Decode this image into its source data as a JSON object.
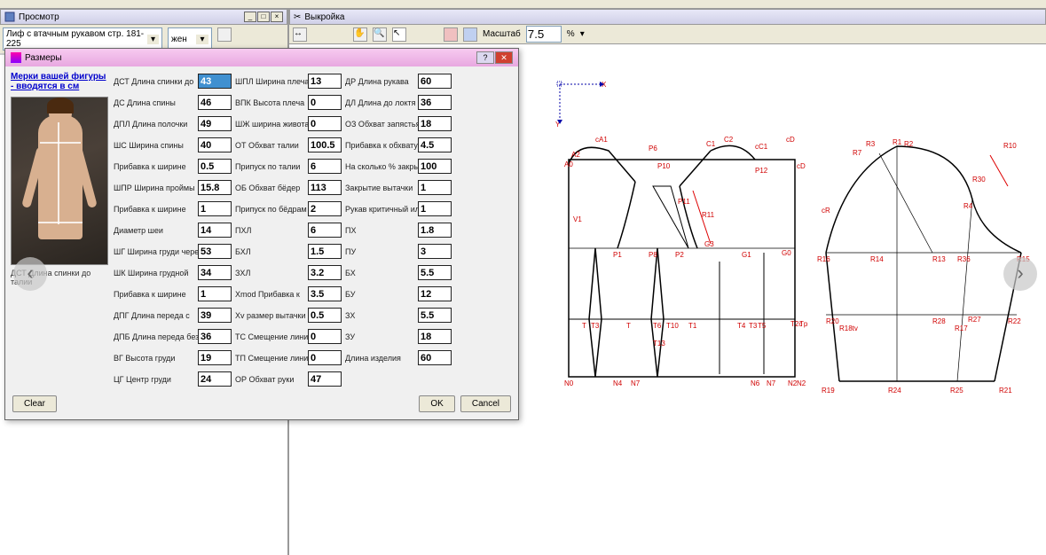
{
  "left_panel": {
    "title": "Просмотр",
    "combo_pattern": "Лиф с втачным рукавом стр. 181-225",
    "combo_gender": "жен"
  },
  "right_panel": {
    "title": "Выкройка",
    "scale_label": "Масштаб",
    "scale_value": "7.5",
    "scale_unit": "%"
  },
  "dialog": {
    "title": "Размеры",
    "link": "Мерки вашей фигуры - вводятся в см",
    "photo_caption": "ДСТ Длина спинки до талии",
    "buttons": {
      "clear": "Clear",
      "ok": "OK",
      "cancel": "Cancel"
    },
    "col1": [
      {
        "label": "ДСТ Длина спинки до",
        "value": "43",
        "hl": true
      },
      {
        "label": "ДС Длина спины",
        "value": "46"
      },
      {
        "label": "ДПЛ Длина полочки",
        "value": "49"
      },
      {
        "label": "ШС Ширина спины",
        "value": "40"
      },
      {
        "label": "Прибавка к ширине",
        "value": "0.5"
      },
      {
        "label": "ШПР Ширина проймы",
        "value": "15.8"
      },
      {
        "label": "Прибавка к ширине",
        "value": "1"
      },
      {
        "label": "Диаметр шеи",
        "value": "14"
      },
      {
        "label": "ШГ Ширина груди через",
        "value": "53"
      },
      {
        "label": "ШК Ширина грудной",
        "value": "34"
      },
      {
        "label": "Прибавка к ширине",
        "value": "1"
      },
      {
        "label": "ДПГ Длина переда с",
        "value": "39"
      },
      {
        "label": "ДПБ Длина переда без",
        "value": "36"
      },
      {
        "label": "ВГ Высота груди",
        "value": "19"
      },
      {
        "label": "ЦГ Центр груди",
        "value": "24"
      }
    ],
    "col2": [
      {
        "label": "ШПЛ Ширина плеча",
        "value": "13"
      },
      {
        "label": "ВПК Высота плеча",
        "value": "0"
      },
      {
        "label": "ШЖ ширина живота",
        "value": "0"
      },
      {
        "label": "ОТ Обхват талии",
        "value": "100.5"
      },
      {
        "label": "Припуск по талии",
        "value": "6"
      },
      {
        "label": "ОБ Обхват бёдер",
        "value": "113"
      },
      {
        "label": "Припуск по бёдрам",
        "value": "2"
      },
      {
        "label": "ПХЛ",
        "value": "6"
      },
      {
        "label": "БХЛ",
        "value": "1.5"
      },
      {
        "label": "ЗХЛ",
        "value": "3.2"
      },
      {
        "label": "Xmod Прибавка к",
        "value": "3.5"
      },
      {
        "label": "Xv размер вытачки на",
        "value": "0.5"
      },
      {
        "label": "ТС Смещение линии",
        "value": "0"
      },
      {
        "label": "ТП Смещение линии",
        "value": "0"
      },
      {
        "label": "ОР Обхват руки",
        "value": "47"
      }
    ],
    "col3": [
      {
        "label": "ДР Длина рукава",
        "value": "60"
      },
      {
        "label": "ДЛ Длина до локтя",
        "value": "36"
      },
      {
        "label": "ОЗ Обхват запястья",
        "value": "18"
      },
      {
        "label": "Прибавка к обхвату",
        "value": "4.5"
      },
      {
        "label": "На сколько % закрыть",
        "value": "100"
      },
      {
        "label": "Закрытие вытачки",
        "value": "1"
      },
      {
        "label": "Рукав критичный или",
        "value": "1"
      },
      {
        "label": "ПХ",
        "value": "1.8"
      },
      {
        "label": "ПУ",
        "value": "3"
      },
      {
        "label": "БХ",
        "value": "5.5"
      },
      {
        "label": "БУ",
        "value": "12"
      },
      {
        "label": "ЗХ",
        "value": "5.5"
      },
      {
        "label": "ЗУ",
        "value": "18"
      },
      {
        "label": "Длина изделия",
        "value": "60"
      }
    ]
  },
  "pattern_labels1": [
    "cA1",
    "A2",
    "A6",
    "P6",
    "P11",
    "P10",
    "P12",
    "C1",
    "C2",
    "cC1",
    "cC",
    "cD",
    "cD",
    "G3",
    "G1",
    "G0",
    "P1",
    "V1",
    "P2",
    "P8",
    "R11",
    "T",
    "T1",
    "T3",
    "T5",
    "T6",
    "T10",
    "T3",
    "T13",
    "T2c",
    "Tp",
    "N0",
    "N4",
    "N6",
    "N7",
    "N2",
    "N2",
    "N7"
  ],
  "pattern_labels2": [
    "R3",
    "R1",
    "R2",
    "R7",
    "R10",
    "R30",
    "cR",
    "R16",
    "R15",
    "R19",
    "R20",
    "R21",
    "R22",
    "R24",
    "R18tv"
  ]
}
